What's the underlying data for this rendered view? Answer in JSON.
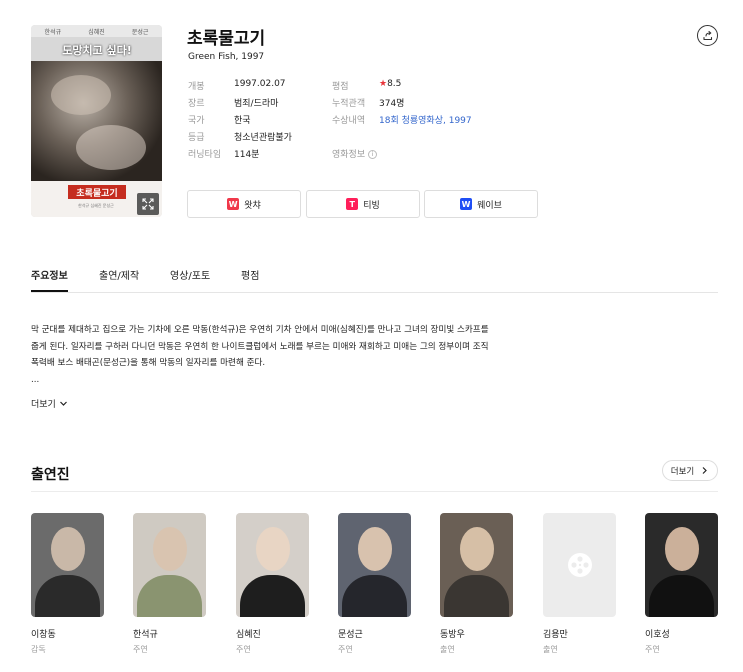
{
  "poster": {
    "top_names": [
      "한석규",
      "심혜진",
      "문성근"
    ],
    "tagline": "도망치고 싶다!",
    "logo_text": "초록물고기",
    "small_text": "한석규 심혜진 문성근"
  },
  "movie": {
    "title": "초록물고기",
    "subtitle": "Green Fish, 1997"
  },
  "info": {
    "left": [
      {
        "label": "개봉",
        "value": "1997.02.07"
      },
      {
        "label": "장르",
        "value": "범죄/드라마"
      },
      {
        "label": "국가",
        "value": "한국"
      },
      {
        "label": "등급",
        "value": "청소년관람불가"
      },
      {
        "label": "러닝타임",
        "value": "114분"
      }
    ],
    "right": [
      {
        "label": "평점",
        "value": "8.5"
      },
      {
        "label": "누적관객",
        "value": "374명"
      },
      {
        "label": "수상내역",
        "value": "18회 청룡영화상, 1997"
      },
      {
        "label": "영화정보",
        "value": ""
      }
    ],
    "star_glyph": "★",
    "info_glyph": "i"
  },
  "ott": [
    {
      "label": "왓챠",
      "icon": "W",
      "color": "#ff0558"
    },
    {
      "label": "티빙",
      "icon": "T",
      "color": "#ff153c"
    },
    {
      "label": "웨이브",
      "icon": "W",
      "color": "#1351f9"
    }
  ],
  "tabs": [
    "주요정보",
    "출연/제작",
    "영상/포토",
    "평점"
  ],
  "synopsis": {
    "lines": [
      "막 군대를 제대하고 집으로 가는 기차에 오른 막동(한석규)은 우연히 기차 안에서 미애(심혜진)를 만나고 그녀의 장미빛 스카프를",
      "줍게 된다. 일자리를 구하러 다니던 막동은 우연히 한 나이트클럽에서 노래를 부르는 미애와 재회하고 미애는 그의 정부이며 조직",
      "폭력배 보스 배태곤(문성근)을 통해 막동의 일자리를 마련해 준다.",
      "..."
    ],
    "more_label": "더보기"
  },
  "cast": {
    "title": "출연진",
    "more_label": "더보기",
    "people": [
      {
        "name": "이창동",
        "role": "감독",
        "bg": "#6b6b6b",
        "skin": "#c9b8a8",
        "cloth": "#2a2a2a"
      },
      {
        "name": "한석규",
        "role": "주연",
        "bg": "#cfcac2",
        "skin": "#d9c4b0",
        "cloth": "#8a9470"
      },
      {
        "name": "심혜진",
        "role": "주연",
        "bg": "#d4cfc9",
        "skin": "#e8d5c4",
        "cloth": "#1e1e1e"
      },
      {
        "name": "문성근",
        "role": "주연",
        "bg": "#5f6470",
        "skin": "#d8c2ae",
        "cloth": "#25262c"
      },
      {
        "name": "동방우",
        "role": "출연",
        "bg": "#6a5f55",
        "skin": "#d6bfa6",
        "cloth": "#3a3632"
      },
      {
        "name": "김용만",
        "role": "출연",
        "bg": "#ececec",
        "skin": "",
        "cloth": ""
      },
      {
        "name": "이호성",
        "role": "주연",
        "bg": "#2a2a2a",
        "skin": "#cbb09a",
        "cloth": "#111111"
      }
    ]
  }
}
